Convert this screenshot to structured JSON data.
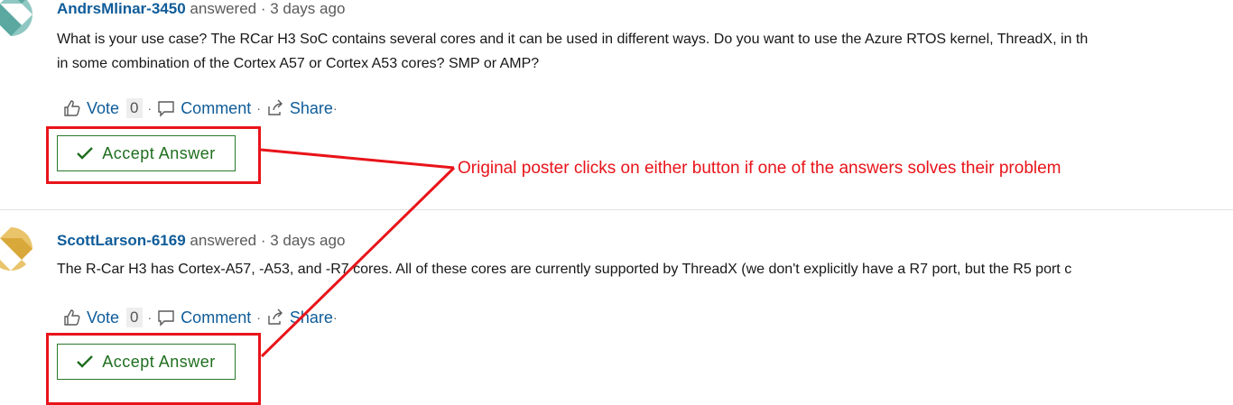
{
  "answers": [
    {
      "author": "AndrsMlinar-3450",
      "meta": "answered · 3 days ago",
      "body_lines": [
        "What is your use case? The RCar H3 SoC contains several cores and it can be used in different ways. Do you want to use the Azure RTOS kernel, ThreadX, in th",
        "in some combination of the Cortex A57 or Cortex A53 cores? SMP or AMP?"
      ],
      "vote_label": "Vote",
      "vote_count": "0",
      "comment_label": "Comment",
      "share_label": "Share",
      "accept_label": "Accept Answer"
    },
    {
      "author": "ScottLarson-6169",
      "meta": "answered · 3 days ago",
      "body_lines": [
        "The R-Car H3 has Cortex-A57, -A53, and -R7 cores. All of these cores are currently supported by ThreadX (we don't explicitly have a R7 port, but the R5 port c"
      ],
      "vote_label": "Vote",
      "vote_count": "0",
      "comment_label": "Comment",
      "share_label": "Share",
      "accept_label": "Accept Answer"
    }
  ],
  "annotation": {
    "text": "Original poster clicks on either button if one of the answers solves their problem",
    "color": "#e8141a"
  },
  "colors": {
    "link": "#0f5c99",
    "accept_green": "#1f6e1f",
    "annotation_red": "#e8141a"
  }
}
